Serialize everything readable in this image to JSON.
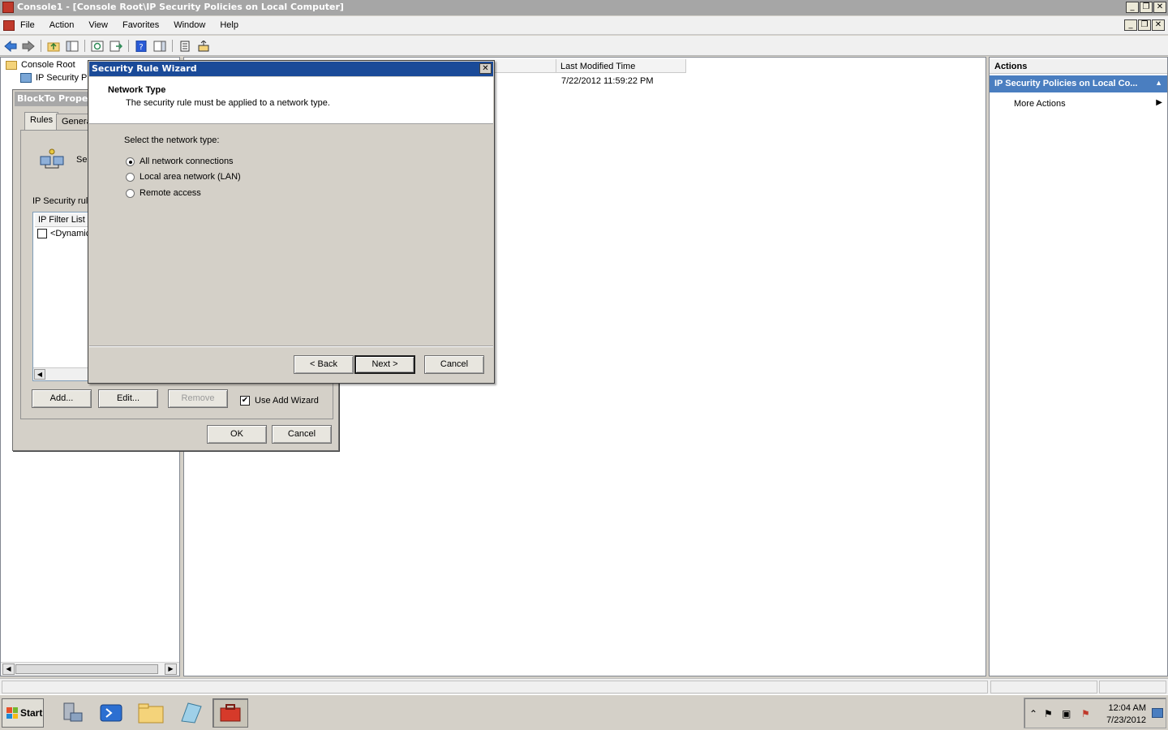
{
  "window": {
    "title": "Console1 - [Console Root\\IP Security Policies on Local Computer]",
    "caption_buttons": [
      "_",
      "❐",
      "✕"
    ]
  },
  "menu": {
    "items": [
      "File",
      "Action",
      "View",
      "Favorites",
      "Window",
      "Help"
    ]
  },
  "toolbar": {
    "icons": [
      "back-arrow-icon",
      "forward-arrow-icon",
      "up-folder-icon",
      "show-hide-tree-icon",
      "refresh-icon",
      "export-list-icon",
      "help-icon",
      "show-hide-action-pane-icon",
      "properties-icon",
      "assign-icon"
    ]
  },
  "tree": {
    "root": "Console Root",
    "child": "IP Security Pr"
  },
  "center": {
    "column_last_modified": "Last Modified Time",
    "row_time": "7/22/2012 11:59:22 PM"
  },
  "actions": {
    "header": "Actions",
    "group": "IP Security Policies on Local Co...",
    "more": "More Actions"
  },
  "properties_dialog": {
    "title": "BlockTo Propert",
    "tabs": [
      "Rules",
      "Genera"
    ],
    "section_label": "Se",
    "rules_label": "IP Security rule",
    "list_header": "IP Filter List",
    "list_row": "<Dynamic",
    "add": "Add...",
    "edit": "Edit...",
    "remove": "Remove",
    "use_wizard": "Use Add Wizard",
    "use_wizard_checked": true,
    "ok": "OK",
    "cancel": "Cancel"
  },
  "wizard": {
    "title": "Security Rule Wizard",
    "heading": "Network Type",
    "subheading": "The security rule must be applied to a network type.",
    "prompt": "Select the network type:",
    "options": [
      {
        "label": "All network connections",
        "selected": true
      },
      {
        "label": "Local area network (LAN)",
        "selected": false
      },
      {
        "label": "Remote access",
        "selected": false
      }
    ],
    "back": "< Back",
    "next": "Next >",
    "cancel": "Cancel"
  },
  "taskbar": {
    "start": "Start",
    "apps": [
      "server-manager-icon",
      "powershell-icon",
      "explorer-folder-icon",
      "notepad-icon",
      "mmc-console-icon"
    ],
    "active_app_index": 4,
    "time": "12:04 AM",
    "date": "7/23/2012"
  },
  "colors": {
    "wizard_title": "#1a4a98",
    "actions_group": "#4a7ec0",
    "inactive_title": "#a6a6a6"
  }
}
